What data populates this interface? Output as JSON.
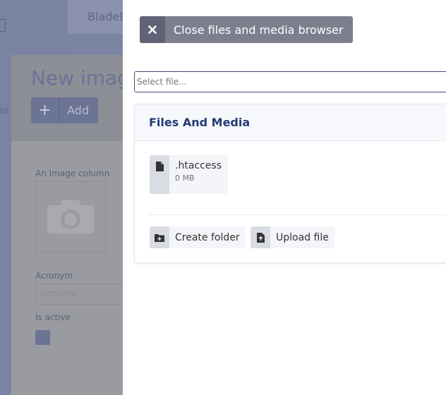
{
  "background": {
    "header_text": "BladeB",
    "side_text": "es",
    "title": "New imag",
    "add_button_label": "Add",
    "image_column_label": "An Image column",
    "acronym_label": "Acronym",
    "acronym_placeholder": "Acronym",
    "is_active_label": "Is active"
  },
  "browser": {
    "close_label": "Close files and media browser",
    "select_placeholder": "Select file...",
    "section_title": "Files And Media",
    "files": [
      {
        "name": ".htaccess",
        "size": "0 MB",
        "icon": "file-icon"
      }
    ],
    "actions": {
      "create_folder": "Create folder",
      "upload_file": "Upload file"
    }
  },
  "colors": {
    "accent": "#253a75",
    "overlay": "#7b84a3",
    "close_button": "#7c7f8e"
  }
}
